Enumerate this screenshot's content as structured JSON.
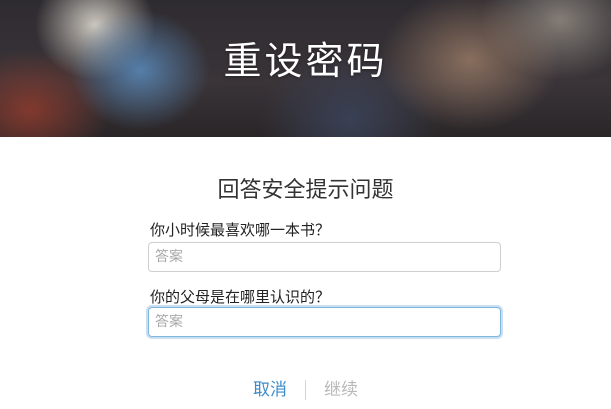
{
  "header": {
    "title": "重设密码"
  },
  "form": {
    "title": "回答安全提示问题",
    "questions": [
      {
        "label": "你小时候最喜欢哪一本书？",
        "placeholder": "答案",
        "value": ""
      },
      {
        "label": "你的父母是在哪里认识的？",
        "placeholder": "答案",
        "value": ""
      }
    ]
  },
  "actions": {
    "cancel_label": "取消",
    "continue_label": "继续"
  },
  "colors": {
    "link_accent": "#3d8bc8",
    "disabled_text": "#b9b9b9",
    "focus_ring": "#7fb6de"
  }
}
